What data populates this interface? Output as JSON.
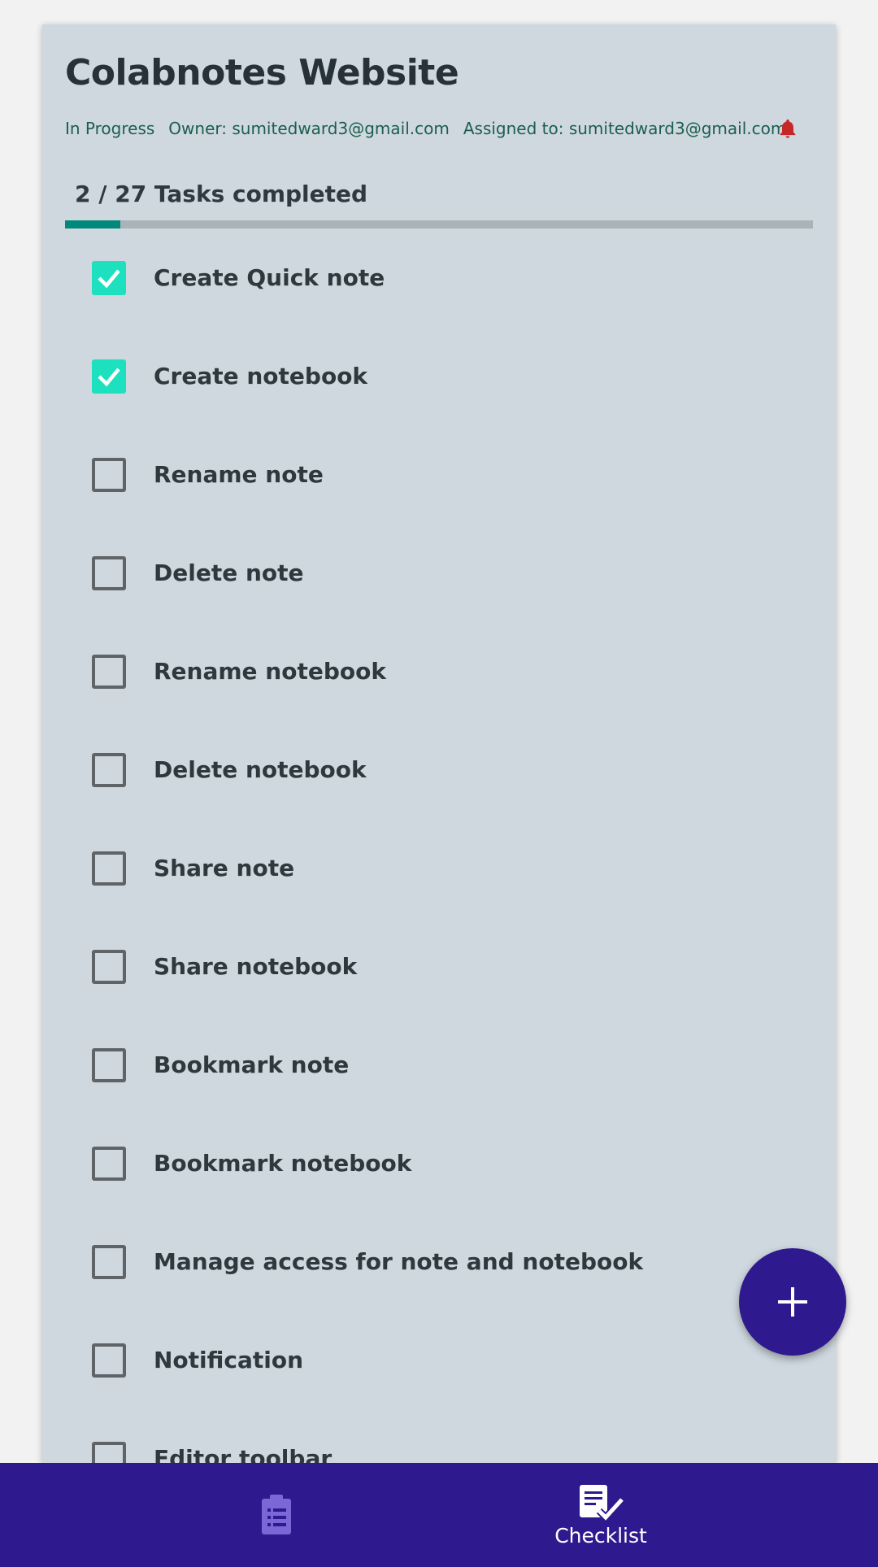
{
  "project": {
    "title": "Colabnotes Website",
    "status": "In Progress",
    "owner": "Owner: sumitedward3@gmail.com",
    "assigned": "Assigned to: sumitedward3@gmail.com"
  },
  "progress": {
    "label": "2 / 27 Tasks completed",
    "completed": 2,
    "total": 27
  },
  "tasks": [
    {
      "label": "Create Quick note",
      "checked": true
    },
    {
      "label": "Create notebook",
      "checked": true
    },
    {
      "label": "Rename note",
      "checked": false
    },
    {
      "label": "Delete note",
      "checked": false
    },
    {
      "label": "Rename notebook",
      "checked": false
    },
    {
      "label": "Delete notebook",
      "checked": false
    },
    {
      "label": "Share note",
      "checked": false
    },
    {
      "label": "Share notebook",
      "checked": false
    },
    {
      "label": "Bookmark note",
      "checked": false
    },
    {
      "label": "Bookmark notebook",
      "checked": false
    },
    {
      "label": "Manage access for note and notebook",
      "checked": false
    },
    {
      "label": "Notification",
      "checked": false
    },
    {
      "label": "Editor toolbar",
      "checked": false
    }
  ],
  "bottom_nav": {
    "notes_icon": "clipboard-list-icon",
    "checklist_icon": "checklist-icon",
    "checklist_label": "Checklist"
  },
  "colors": {
    "accent": "#2e1a8e",
    "check": "#1de0bf",
    "progress": "#00897b",
    "bell": "#c62828"
  }
}
